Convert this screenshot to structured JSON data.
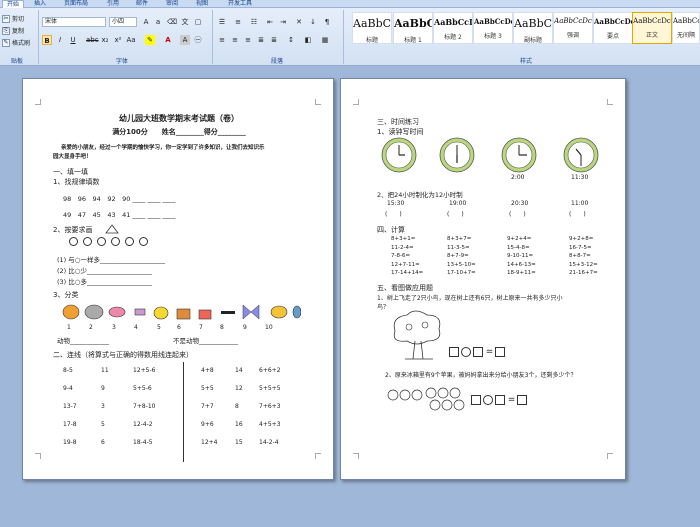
{
  "ribbon": {
    "tabs": [
      "开始",
      "插入",
      "页面布局",
      "引用",
      "邮件",
      "审阅",
      "视图",
      "开发工具"
    ],
    "clipboard": {
      "cut": "剪切",
      "copy": "复制",
      "format_painter": "格式刷",
      "label": "贴板"
    },
    "font": {
      "name": "宋体",
      "size": "小四",
      "label": "字体"
    },
    "paragraph": {
      "label": "段落"
    },
    "styles": {
      "label": "样式",
      "items": [
        {
          "sample": "AaBbC",
          "name": "标题"
        },
        {
          "sample": "AaBbC",
          "name": "标题 1"
        },
        {
          "sample": "AaBbCcD",
          "name": "标题 2"
        },
        {
          "sample": "AaBbCcDd",
          "name": "标题 3"
        },
        {
          "sample": "AaBbC",
          "name": "副标题"
        },
        {
          "sample": "AaBbCcDc",
          "name": "强调"
        },
        {
          "sample": "AaBbCcDd",
          "name": "要点"
        },
        {
          "sample": "AaBbCcDc",
          "name": "正文"
        },
        {
          "sample": "AaBbCcDc",
          "name": "无间隔"
        }
      ]
    }
  },
  "page1": {
    "title": "幼儿园大班数学期末考试题（卷）",
    "score_line": "满分100分　　姓名________得分________",
    "intro1": "亲爱的小朋友，经过一个学期的愉快学习，你一定学到了许多知识，让我们去知识乐",
    "intro2": "园大显身手吧！",
    "s1": "一、填一填",
    "s1_1": "1、找规律填数",
    "row1": "98　96　94　92　90 ____ ____ ____",
    "row2": "49　47　45　43　41 ____ ____ ____",
    "s1_2": "2、按要求画",
    "draw1": "(1) 与○一样多____________________",
    "draw2": "(2) 比○少____________________",
    "draw3": "(3) 比○多____________________",
    "s1_3": "3、分类",
    "nums": [
      "1",
      "2",
      "3",
      "4",
      "5",
      "6",
      "7",
      "8",
      "9",
      "10"
    ],
    "cat_animal": "动物____________",
    "cat_not": "不是动物____________",
    "s2": "二、连线（将算式与正确的得数用线连起来）",
    "link_rows": [
      [
        "8-5",
        "11",
        "12+5-6",
        "4+8",
        "14",
        "6+6+2"
      ],
      [
        "9-4",
        "9",
        "5+5-6",
        "5+5",
        "12",
        "5+5+5"
      ],
      [
        "13-7",
        "3",
        "7+8-10",
        "7+7",
        "8",
        "7+6+3"
      ],
      [
        "17-8",
        "5",
        "12-4-2",
        "9+6",
        "16",
        "4+5+3"
      ],
      [
        "19-8",
        "6",
        "18-4-5",
        "12+4",
        "15",
        "14-2-4"
      ]
    ]
  },
  "page2": {
    "s3": "三、时间练习",
    "s3_1": "1、读钟写时间",
    "clock_times": [
      "2:00",
      "11:30"
    ],
    "s3_2": "2、把24小时制化为12小时制",
    "t24": [
      "15:30",
      "19:00",
      "20:30",
      "11:00"
    ],
    "t12": [
      "(　　)",
      "(　　)",
      "(　　)",
      "(　　)"
    ],
    "s4": "四、计算",
    "calc": [
      [
        "8+3+1=",
        "8+3+7=",
        "9+2+4=",
        "9+2+8="
      ],
      [
        "11-2-4=",
        "11-3-5=",
        "15-4-8=",
        "16-7-5="
      ],
      [
        "7-8-6=",
        "8+7-9=",
        "9-10-11=",
        "8+8-7="
      ],
      [
        "12+7-11=",
        "13+5-10=",
        "14+6-13=",
        "15+3-12="
      ],
      [
        "17-14+14=",
        "17-10+7=",
        "18-9+11=",
        "21-16+7="
      ]
    ],
    "s5": "五、看图做应用题",
    "q1": "1、树上飞走了2只小鸟，现在树上还有6只，树上原来一共有多少只小",
    "q1b": "鸟？",
    "q2": "2、原来冰箱里有9个苹果，被妈妈拿出来分给小朋友3个，还剩多少个？"
  },
  "colors": {
    "accent": "#15428b",
    "ribbon": "#d3e1f3",
    "workspace": "#9fb7d8"
  }
}
